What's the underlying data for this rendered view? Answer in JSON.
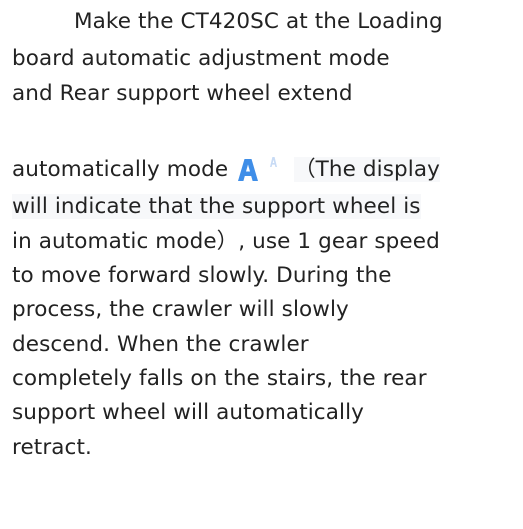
{
  "paragraph": {
    "line1": "Make the CT420SC at the Loading",
    "line2": "board automatic adjustment mode",
    "line3": "and Rear support wheel extend",
    "line4_before_icon": "automatically mode",
    "line4_after_icon": "（The display",
    "line5": "will indicate that the support wheel is",
    "line6": "in automatic mode）, use 1 gear speed",
    "line7": "to move forward slowly. During the",
    "line8": "process, the crawler will slowly",
    "line9": "descend. When the crawler",
    "line10": "completely falls on the stairs, the rear",
    "line11": "support wheel will automatically",
    "line12": "retract."
  },
  "icon": {
    "name": "auto-mode-a-icon",
    "color": "#3f8ee8"
  }
}
